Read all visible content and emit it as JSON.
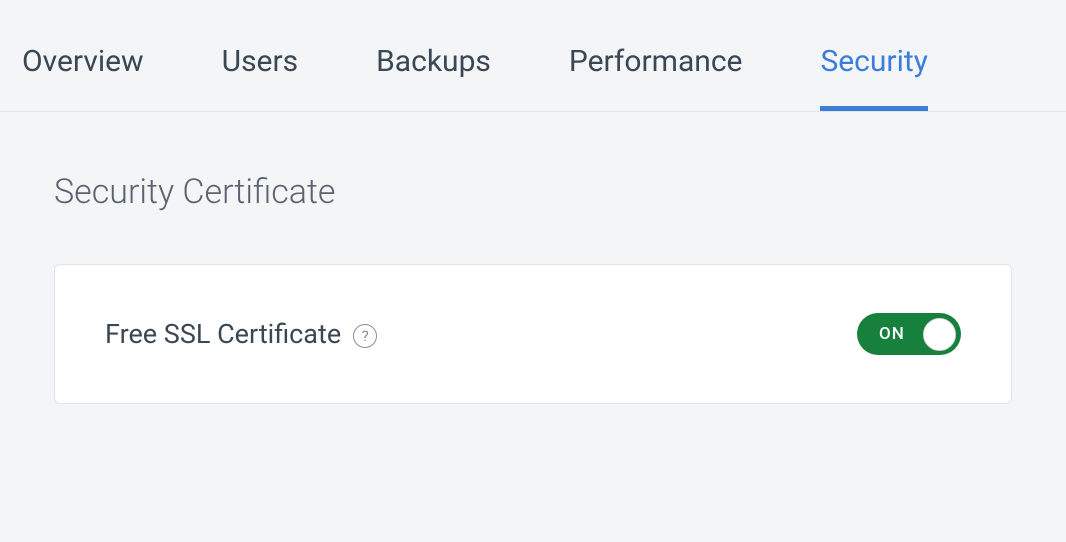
{
  "tabs": [
    {
      "label": "Overview",
      "active": false
    },
    {
      "label": "Users",
      "active": false
    },
    {
      "label": "Backups",
      "active": false
    },
    {
      "label": "Performance",
      "active": false
    },
    {
      "label": "Security",
      "active": true
    }
  ],
  "section": {
    "title": "Security Certificate"
  },
  "ssl": {
    "label": "Free SSL Certificate",
    "toggle_state_label": "ON"
  }
}
